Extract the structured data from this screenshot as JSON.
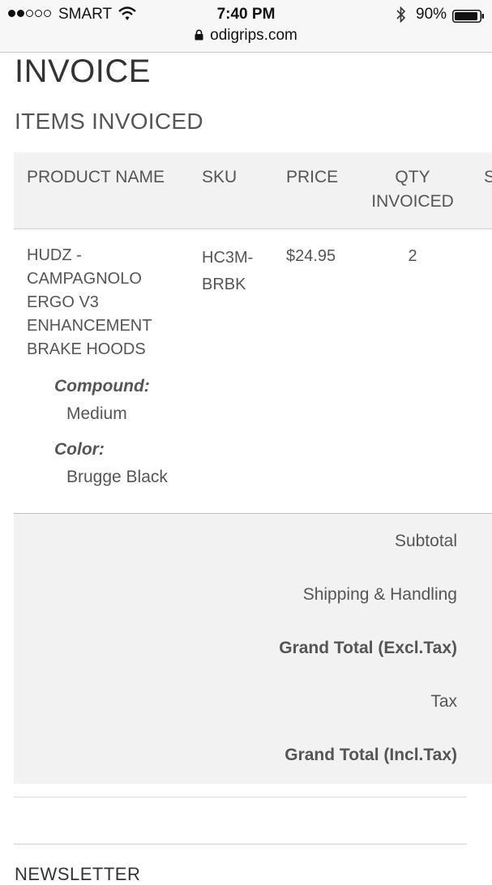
{
  "status_bar": {
    "carrier": "SMART",
    "time": "7:40 PM",
    "battery": "90%",
    "url": "odigrips.com"
  },
  "page": {
    "title": "INVOICE",
    "section_title": "ITEMS INVOICED"
  },
  "table": {
    "columns": {
      "product": "PRODUCT NAME",
      "sku": "SKU",
      "price": "PRICE",
      "qty_line1": "QTY",
      "qty_line2": "INVOICED",
      "subtotal_partial": "S"
    },
    "row": {
      "product_lines": [
        "HUDZ -",
        "CAMPAGNOLO",
        "ERGO V3",
        "ENHANCEMENT",
        "BRAKE HOODS"
      ],
      "sku_lines": [
        "HC3M-",
        "BRBK"
      ],
      "price": "$24.95",
      "qty": "2",
      "options": [
        {
          "label": "Compound:",
          "value": "Medium"
        },
        {
          "label": "Color:",
          "value": "Brugge Black"
        }
      ]
    }
  },
  "totals": {
    "subtotal": "Subtotal",
    "shipping": "Shipping & Handling",
    "grand_excl": "Grand Total (Excl.Tax)",
    "tax": "Tax",
    "grand_incl": "Grand Total (Incl.Tax)"
  },
  "footer": {
    "newsletter": "NEWSLETTER"
  }
}
